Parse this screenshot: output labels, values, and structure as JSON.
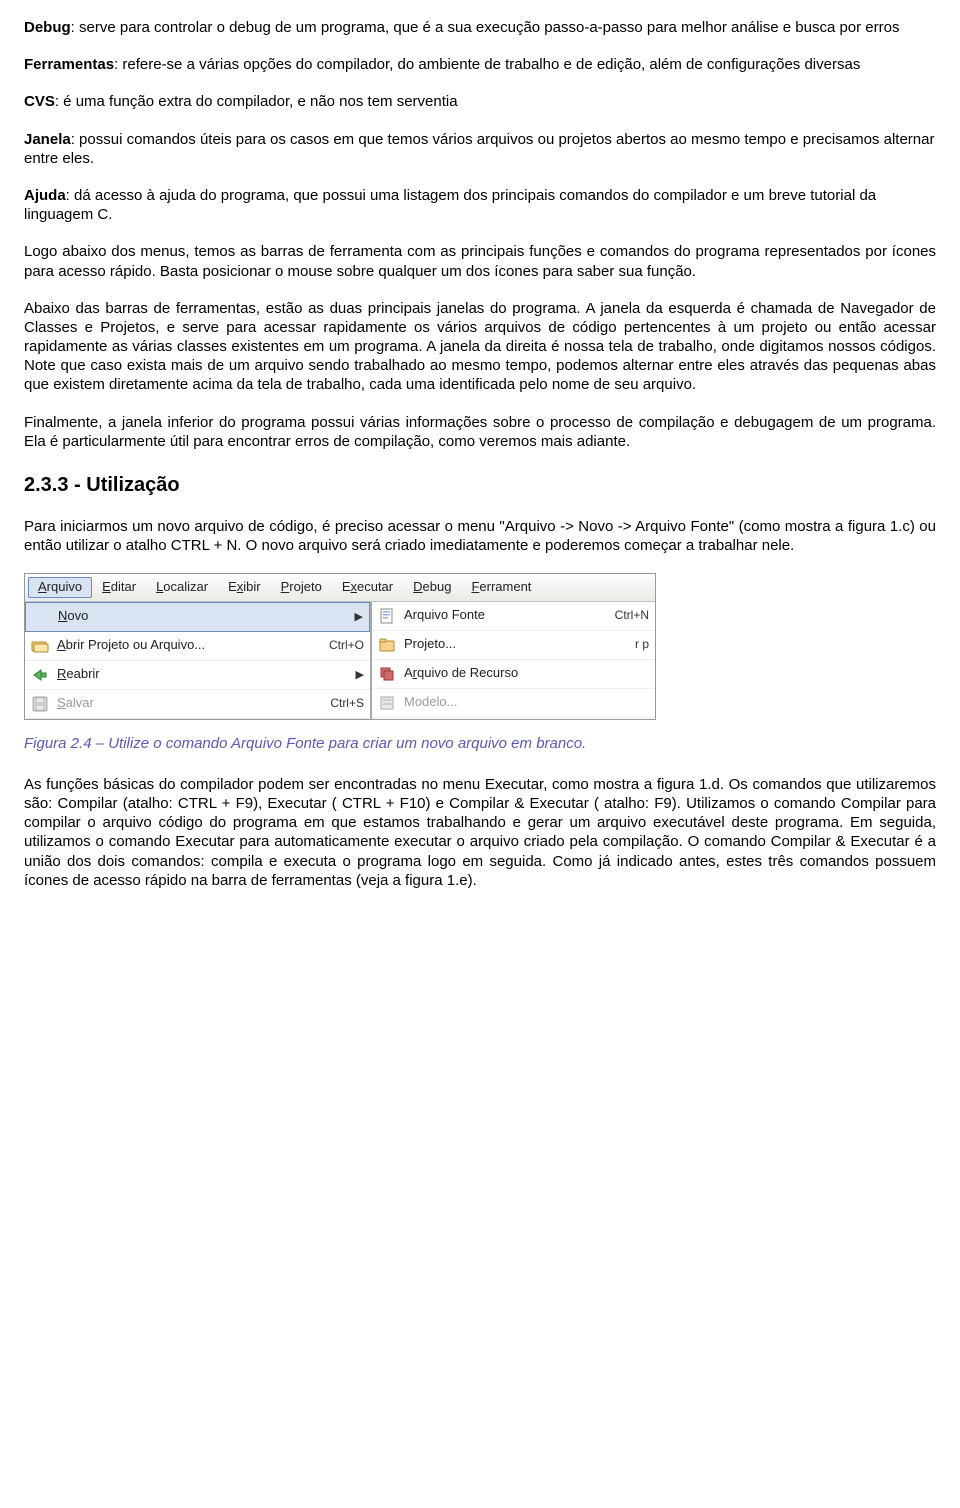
{
  "paras": {
    "debug_label": "Debug",
    "debug_text": ": serve para controlar o debug de um programa, que é a sua execução passo-a-passo para melhor análise e busca por erros",
    "ferr_label": "Ferramentas",
    "ferr_text": ": refere-se a várias opções do compilador, do ambiente de trabalho e de edição, além de configurações diversas",
    "cvs_label": "CVS",
    "cvs_text": ": é uma função extra do compilador, e não nos tem serventia",
    "janela_label": "Janela",
    "janela_text": ": possui comandos úteis para os casos em que temos vários arquivos ou projetos abertos ao mesmo tempo e precisamos alternar entre eles.",
    "ajuda_label": "Ajuda",
    "ajuda_text": ": dá acesso à ajuda do programa, que possui uma listagem dos principais comandos do compilador e um breve tutorial da linguagem C.",
    "p1": "Logo abaixo dos menus, temos as barras de ferramenta com as principais funções e comandos do programa representados por ícones para acesso rápido. Basta posicionar o mouse sobre qualquer um dos ícones para saber sua função.",
    "p2": "Abaixo das barras de ferramentas, estão as duas principais janelas do programa. A janela da esquerda é chamada de Navegador de Classes e Projetos, e serve para acessar rapidamente os vários arquivos de código pertencentes à um projeto ou então acessar rapidamente as várias classes existentes em um programa. A janela da direita é nossa tela de trabalho, onde digitamos nossos códigos. Note que caso exista mais de um arquivo sendo trabalhado ao mesmo tempo, podemos alternar entre eles através das pequenas abas que existem diretamente acima da tela de trabalho, cada uma identificada pelo nome de seu arquivo.",
    "p3": "Finalmente, a janela inferior do programa possui várias informações sobre o processo de compilação e debugagem de um programa. Ela é particularmente útil para encontrar erros de compilação, como veremos mais adiante.",
    "h2": "2.3.3 - Utilização",
    "p4": "Para iniciarmos um novo arquivo de código, é preciso acessar o menu \"Arquivo -> Novo -> Arquivo Fonte\" (como mostra a figura 1.c) ou então utilizar o atalho CTRL + N. O novo arquivo será criado imediatamente e poderemos começar a trabalhar nele.",
    "caption": "Figura 2.4 – Utilize o comando Arquivo Fonte para criar um novo arquivo em branco.",
    "p5": "As funções básicas do compilador podem ser encontradas no menu Executar, como mostra a figura 1.d. Os comandos que utilizaremos são: Compilar (atalho: CTRL + F9), Executar ( CTRL + F10) e Compilar & Executar ( atalho: F9). Utilizamos o comando Compilar para compilar o arquivo código do programa em que estamos trabalhando e gerar um arquivo executável deste programa. Em seguida, utilizamos o comando Executar para automaticamente executar o arquivo criado pela compilação. O comando Compilar & Executar é a união dos dois comandos: compila e executa o programa logo em seguida. Como já indicado antes, estes três comandos possuem ícones de acesso rápido na barra de ferramentas (veja a figura 1.e)."
  },
  "ui": {
    "menus": {
      "arquivo": "Arquivo",
      "editar": "Editar",
      "localizar": "Localizar",
      "exibir": "Exibir",
      "projeto": "Projeto",
      "executar": "Executar",
      "debug": "Debug",
      "ferrament": "Ferrament"
    },
    "left": {
      "novo": "Novo",
      "abrir": "Abrir Projeto ou Arquivo...",
      "abrir_sc": "Ctrl+O",
      "reabrir": "Reabrir",
      "salvar": "Salvar",
      "salvar_sc": "Ctrl+S"
    },
    "right": {
      "fonte": "Arquivo Fonte",
      "fonte_sc": "Ctrl+N",
      "projeto": "Projeto...",
      "recurso": "Arquivo de Recurso",
      "modelo": "Modelo..."
    }
  }
}
